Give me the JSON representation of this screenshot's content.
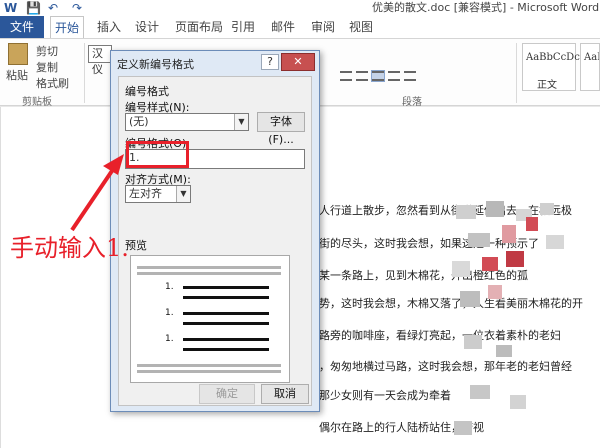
{
  "titlebar": {
    "title": "优美的散文.doc [兼容模式] - Microsoft Word",
    "word_icon": "word-icon",
    "save_icon": "save-icon",
    "undo_icon": "undo-icon",
    "redo_icon": "redo-icon"
  },
  "tabs": [
    "文件",
    "开始",
    "插入",
    "设计",
    "页面布局",
    "引用",
    "邮件",
    "审阅",
    "视图"
  ],
  "ribbon": {
    "paste": "粘贴",
    "cut": "剪切",
    "copy": "复制",
    "format_painter": "格式刷",
    "clipboard_group": "剪贴板",
    "font_name": "汉仪",
    "paragraph_group": "段落",
    "style_sample": "AaBbCcDc",
    "style_name": "正文",
    "style_sample_2": "AaBb"
  },
  "dialog": {
    "title": "定义新编号格式",
    "help": "?",
    "close": "✕",
    "section_label": "编号格式",
    "number_style_label": "编号样式(N):",
    "number_style_value": "(无)",
    "font_button": "字体(F)...",
    "number_format_label": "编号格式(O):",
    "number_format_value": "1.",
    "alignment_label": "对齐方式(M):",
    "alignment_value": "左对齐",
    "preview_label": "预览",
    "preview_numbers": [
      "1.",
      "1.",
      "1."
    ],
    "ok_button": "确定",
    "cancel_button": "取消"
  },
  "document": {
    "lines": [
      "人行道上散步，忽然看到从街道延伸出去，在极远极",
      "街的尽头，这时我会想，如果这是一种预示了",
      "某一条路上，见到木棉花，开出橙红色的孤",
      "势，这时我会想，木棉又落了，人生看美丽木棉花的开",
      "路旁的咖啡座，看绿灯亮起，一位衣着素朴的老妇",
      "，匆匆地横过马路，这时我会想，那年老的老妇曾经",
      "那少女则有一天会成为牵着",
      "偶尔在路上的行人陆桥站住，俯视"
    ]
  },
  "annotation": {
    "text": "手动输入1.",
    "color": "#e8202a"
  },
  "colors": {
    "accent": "#2b579a",
    "annotation": "#e8202a"
  }
}
